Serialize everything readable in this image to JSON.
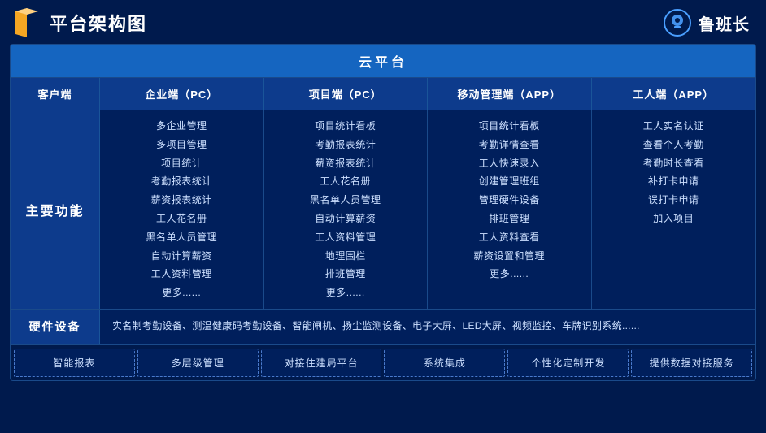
{
  "header": {
    "title": "平台架构图",
    "brand": "鲁班长"
  },
  "cloud_platform": "云平台",
  "columns": {
    "client": "客户端",
    "enterprise_pc": "企业端（PC）",
    "project_pc": "项目端（PC）",
    "mobile_app": "移动管理端（APP）",
    "worker_app": "工人端（APP）"
  },
  "main_function_label": "主要功能",
  "enterprise_features": [
    "多企业管理",
    "多项目管理",
    "项目统计",
    "考勤报表统计",
    "薪资报表统计",
    "工人花名册",
    "黑名单人员管理",
    "自动计算薪资",
    "工人资料管理",
    "更多......"
  ],
  "project_features": [
    "项目统计看板",
    "考勤报表统计",
    "薪资报表统计",
    "工人花名册",
    "黑名单人员管理",
    "自动计算薪资",
    "工人资料管理",
    "地理围栏",
    "排班管理",
    "更多......"
  ],
  "mobile_features": [
    "项目统计看板",
    "考勤详情查看",
    "工人快速录入",
    "创建管理班组",
    "管理硬件设备",
    "排班管理",
    "工人资料查看",
    "薪资设置和管理",
    "更多......"
  ],
  "worker_features": [
    "工人实名认证",
    "查看个人考勤",
    "考勤时长查看",
    "补打卡申请",
    "误打卡申请",
    "加入项目"
  ],
  "hardware_label": "硬件设备",
  "hardware_content": "实名制考勤设备、测温健康码考勤设备、智能闸机、扬尘监测设备、电子大屏、LED大屏、视频监控、车牌识别系统......",
  "bottom_features": [
    "智能报表",
    "多层级管理",
    "对接住建局平台",
    "系统集成",
    "个性化定制开发",
    "提供数据对接服务"
  ]
}
